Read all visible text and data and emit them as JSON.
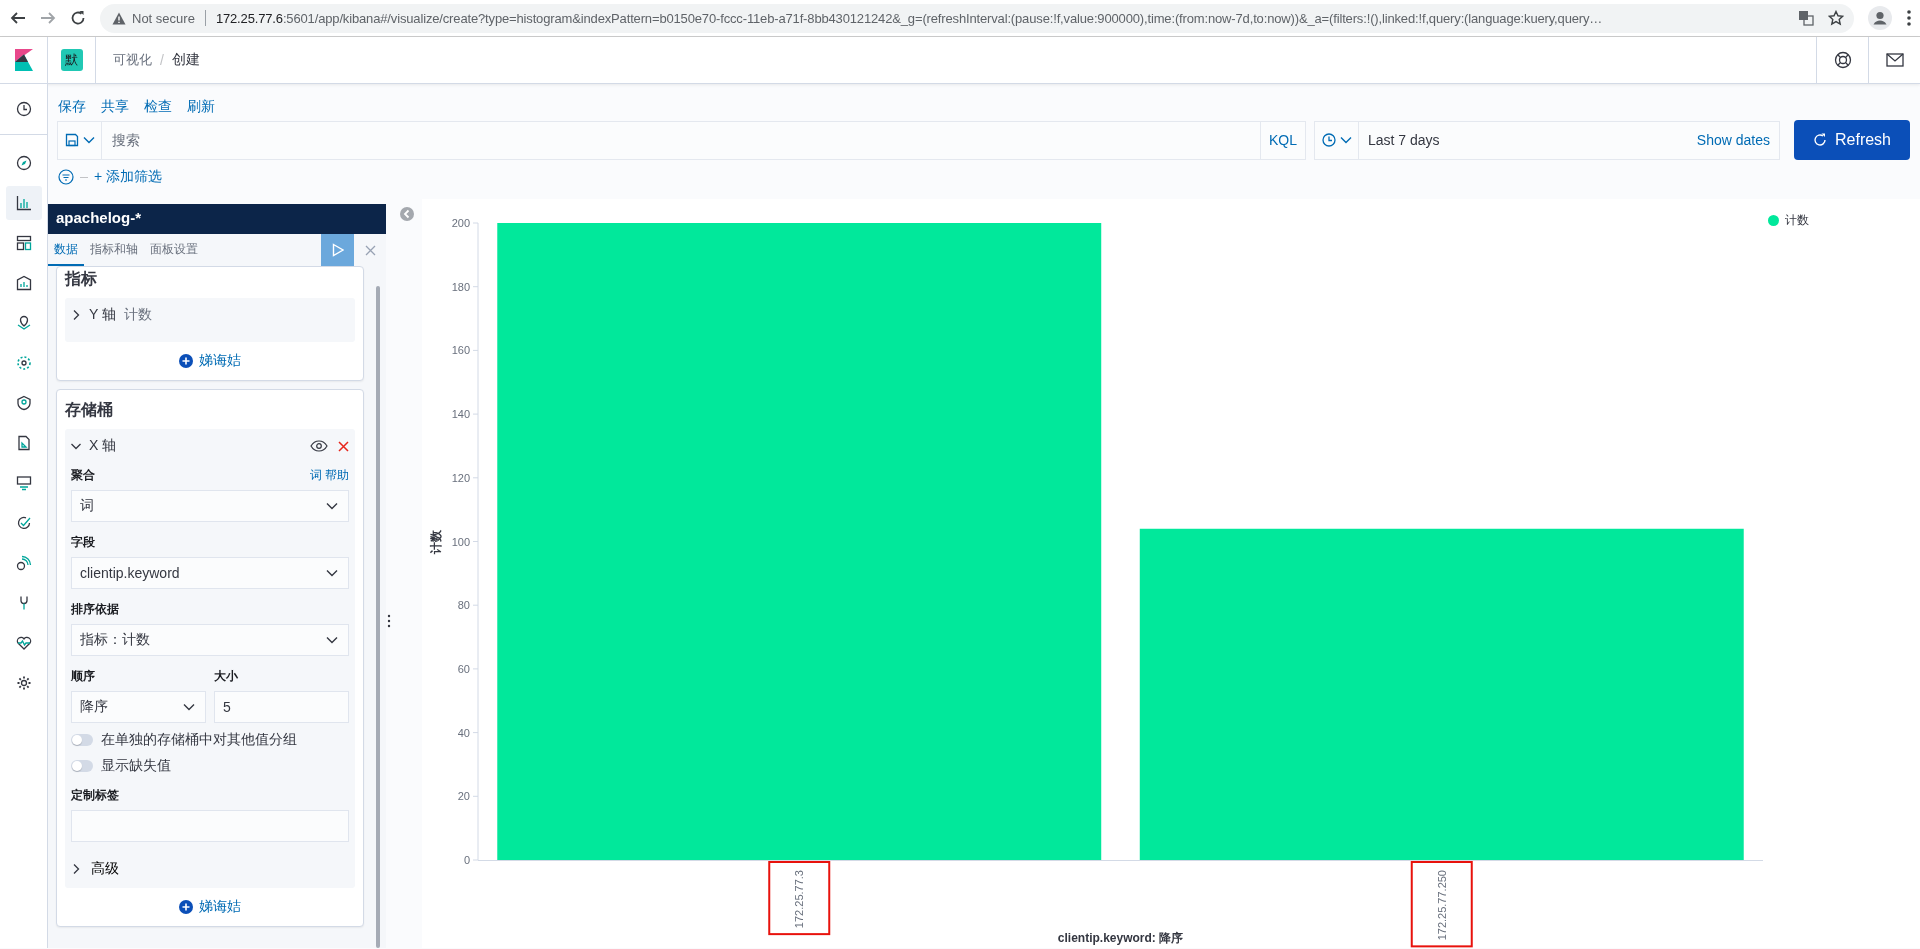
{
  "browser": {
    "security": "Not secure",
    "url_host": "172.25.77.6",
    "url_path": ":5601/app/kibana#/visualize/create?type=histogram&indexPattern=b0150e70-fccc-11eb-a71f-8bb430121242&_g=(refreshInterval:(pause:!f,value:900000),time:(from:now-7d,to:now))&_a=(filters:!(),linked:!f,query:(language:kuery,query…"
  },
  "header": {
    "space_badge": "默",
    "breadcrumb_separator": "/",
    "breadcrumbs": [
      {
        "label": "可视化",
        "current": false
      },
      {
        "label": "创建",
        "current": true
      }
    ]
  },
  "nav_items": [
    {
      "selected": false
    },
    {
      "selected": false
    },
    {
      "selected": true
    },
    {
      "selected": false
    },
    {
      "selected": false
    },
    {
      "selected": false
    },
    {
      "selected": false
    },
    {
      "selected": false
    },
    {
      "selected": false
    },
    {
      "selected": false
    },
    {
      "selected": false
    },
    {
      "selected": false
    },
    {
      "selected": false
    },
    {
      "selected": false
    },
    {
      "selected": false
    }
  ],
  "top_menu": [
    "保存",
    "共享",
    "检查",
    "刷新"
  ],
  "query_bar": {
    "placeholder": "搜索",
    "language": "KQL",
    "date_range": "Last 7 days",
    "show_dates": "Show dates",
    "refresh": "Refresh"
  },
  "filter_bar": {
    "add_filter": "+ 添加筛选"
  },
  "editor": {
    "index_pattern": "apachelog-*",
    "apply_disabled": true,
    "tabs": [
      {
        "label": "数据",
        "selected": true
      },
      {
        "label": "指标和轴",
        "selected": false
      },
      {
        "label": "面板设置",
        "selected": false
      }
    ],
    "sections": [
      {
        "title": "指标",
        "items": [
          {
            "title": "Y 轴",
            "description": "计数",
            "expanded": false
          }
        ],
        "add_button": "娣诲姞"
      },
      {
        "title": "存储桶",
        "items": [
          {
            "title": "X 轴",
            "expanded": true,
            "fields": [
              {
                "kind": "select",
                "label": "聚合",
                "help": "词 帮助",
                "value": "词"
              },
              {
                "kind": "select",
                "label": "字段",
                "value": "clientip.keyword"
              },
              {
                "kind": "select",
                "label": "排序依据",
                "value": "指标：计数"
              },
              {
                "kind": "pair",
                "items": [
                  {
                    "kind": "select",
                    "label": "顺序",
                    "value": "降序"
                  },
                  {
                    "kind": "number",
                    "label": "大小",
                    "value": "5"
                  }
                ]
              },
              {
                "kind": "switch",
                "label": "在单独的存储桶中对其他值分组",
                "on": false
              },
              {
                "kind": "switch",
                "label": "显示缺失值",
                "on": false
              },
              {
                "kind": "text",
                "label": "定制标签"
              },
              {
                "kind": "accordion",
                "label": "高级",
                "expanded": false
              }
            ]
          }
        ],
        "add_button": "娣诲姞"
      }
    ]
  },
  "chart": {
    "x_ticks": [
      {
        "boxed": true
      },
      {
        "boxed": true
      }
    ],
    "chart_data": {
      "type": "bar",
      "xlabel": "clientip.keyword: 降序",
      "ylabel": "计数",
      "categories": [
        "172.25.77.3",
        "172.25.77.250"
      ],
      "series": [
        {
          "name": "计数",
          "color": "#01e89b",
          "values": [
            200,
            104
          ]
        }
      ],
      "ylim": [
        0,
        200
      ],
      "yticks": [
        0,
        20,
        40,
        60,
        80,
        100,
        120,
        140,
        160,
        180,
        200
      ]
    }
  }
}
